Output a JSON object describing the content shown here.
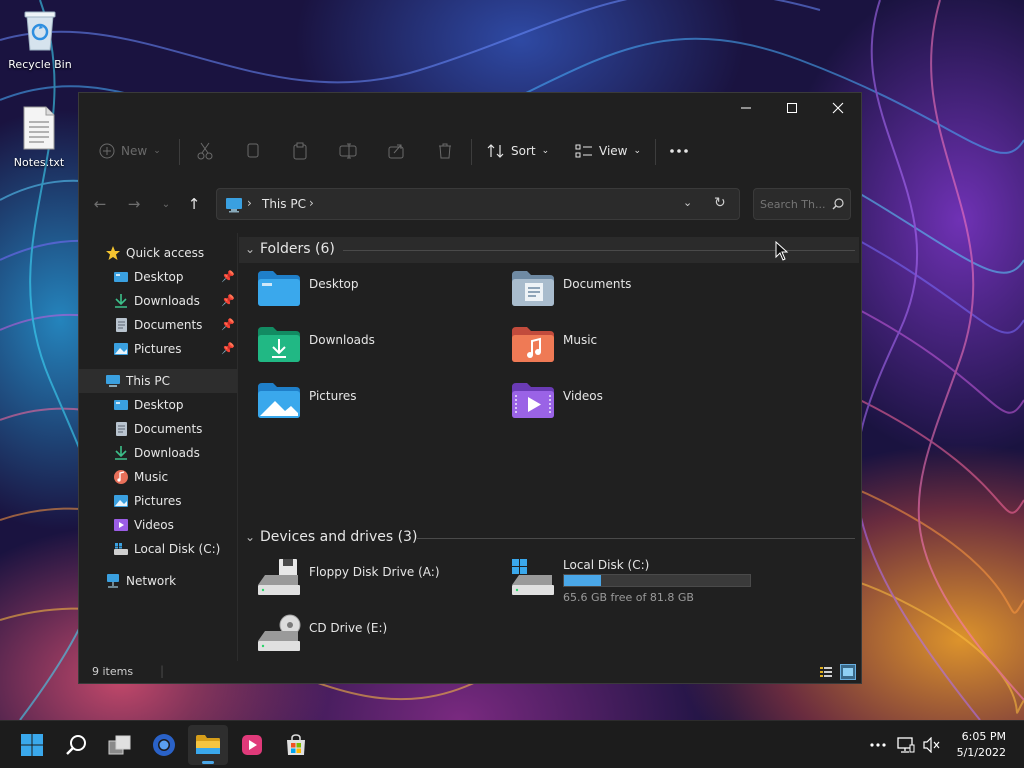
{
  "desktop": {
    "icons": [
      {
        "label": "Recycle Bin",
        "icon": "recycle-bin-icon"
      },
      {
        "label": "Notes.txt",
        "icon": "text-file-icon"
      }
    ]
  },
  "window": {
    "controls": {
      "minimize": "minimize-icon",
      "maximize": "maximize-icon",
      "close": "close-icon"
    },
    "commandbar": {
      "new_label": "New",
      "sort_label": "Sort",
      "view_label": "View",
      "disabled_actions": [
        "cut-icon",
        "copy-icon",
        "paste-icon",
        "rename-icon",
        "share-icon",
        "delete-icon"
      ],
      "more": "more-icon"
    },
    "address": {
      "segments": [
        "This PC"
      ],
      "icon": "this-pc-icon"
    },
    "search": {
      "placeholder": "Search Th..."
    },
    "nav": {
      "quick_access": {
        "label": "Quick access",
        "icon": "star-icon",
        "items": [
          {
            "label": "Desktop",
            "icon": "desktop-folder-icon",
            "pinned": true
          },
          {
            "label": "Downloads",
            "icon": "downloads-icon",
            "pinned": true
          },
          {
            "label": "Documents",
            "icon": "documents-icon",
            "pinned": true
          },
          {
            "label": "Pictures",
            "icon": "pictures-icon",
            "pinned": true
          }
        ]
      },
      "this_pc": {
        "label": "This PC",
        "icon": "this-pc-icon",
        "items": [
          {
            "label": "Desktop",
            "icon": "desktop-folder-icon"
          },
          {
            "label": "Documents",
            "icon": "documents-icon"
          },
          {
            "label": "Downloads",
            "icon": "downloads-icon"
          },
          {
            "label": "Music",
            "icon": "music-icon"
          },
          {
            "label": "Pictures",
            "icon": "pictures-icon"
          },
          {
            "label": "Videos",
            "icon": "videos-icon"
          },
          {
            "label": "Local Disk (C:)",
            "icon": "local-disk-icon"
          }
        ]
      },
      "network": {
        "label": "Network",
        "icon": "network-icon"
      }
    },
    "folders": {
      "heading": "Folders (6)",
      "items": [
        {
          "label": "Desktop",
          "icon": "desktop-folder-icon"
        },
        {
          "label": "Documents",
          "icon": "documents-folder-icon"
        },
        {
          "label": "Downloads",
          "icon": "downloads-folder-icon"
        },
        {
          "label": "Music",
          "icon": "music-folder-icon"
        },
        {
          "label": "Pictures",
          "icon": "pictures-folder-icon"
        },
        {
          "label": "Videos",
          "icon": "videos-folder-icon"
        }
      ]
    },
    "drives": {
      "heading": "Devices and drives (3)",
      "items": [
        {
          "label": "Floppy Disk Drive (A:)",
          "icon": "floppy-drive-icon"
        },
        {
          "label": "Local Disk (C:)",
          "icon": "local-disk-icon",
          "free_text": "65.6 GB free of 81.8 GB",
          "used_fraction": 0.2
        },
        {
          "label": "CD Drive (E:)",
          "icon": "cd-drive-icon"
        }
      ]
    },
    "status": {
      "items_count": "9 items"
    }
  },
  "taskbar": {
    "apps": [
      "start-icon",
      "search-icon",
      "task-view-icon",
      "browser-icon",
      "file-explorer-icon",
      "media-player-icon",
      "store-icon"
    ],
    "tray": [
      "tray-overflow-icon",
      "network-status-icon",
      "volume-muted-icon"
    ],
    "clock": {
      "time": "6:05 PM",
      "date": "5/1/2022"
    }
  },
  "colors": {
    "accent": "#4aa7e8",
    "window_bg": "#202020",
    "taskbar_bg": "#1c1c1c",
    "disk_bar_fill": "#4aa7e8",
    "disk_bar_track": "#3a3a3a"
  }
}
